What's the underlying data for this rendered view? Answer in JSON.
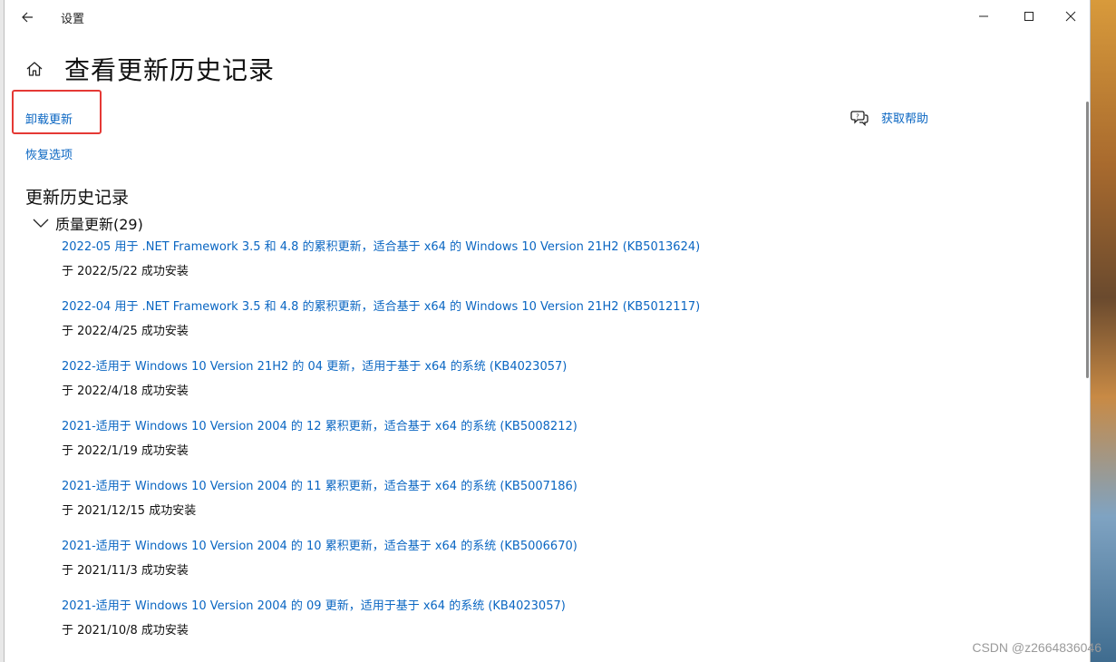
{
  "window": {
    "title": "设置",
    "controls": {
      "minimize": "minimize-icon",
      "maximize": "maximize-icon",
      "close": "close-icon"
    }
  },
  "header": {
    "title": "查看更新历史记录"
  },
  "actions": {
    "uninstall": "卸载更新",
    "recovery": "恢复选项",
    "help": "获取帮助"
  },
  "history": {
    "section_title": "更新历史记录",
    "group_label": "质量更新(29)",
    "items": [
      {
        "title": "2022-05 用于 .NET Framework 3.5 和 4.8 的累积更新，适合基于 x64 的 Windows 10 Version 21H2 (KB5013624)",
        "status": "于 2022/5/22 成功安装"
      },
      {
        "title": "2022-04 用于 .NET Framework 3.5 和 4.8 的累积更新，适合基于 x64 的 Windows 10 Version 21H2 (KB5012117)",
        "status": "于 2022/4/25 成功安装"
      },
      {
        "title": "2022-适用于 Windows 10 Version 21H2 的 04 更新，适用于基于 x64 的系统 (KB4023057)",
        "status": "于 2022/4/18 成功安装"
      },
      {
        "title": "2021-适用于 Windows 10 Version 2004 的 12 累积更新，适合基于 x64 的系统 (KB5008212)",
        "status": "于 2022/1/19 成功安装"
      },
      {
        "title": "2021-适用于 Windows 10 Version 2004 的 11 累积更新，适合基于 x64 的系统 (KB5007186)",
        "status": "于 2021/12/15 成功安装"
      },
      {
        "title": "2021-适用于 Windows 10 Version 2004 的 10 累积更新，适合基于 x64 的系统 (KB5006670)",
        "status": "于 2021/11/3 成功安装"
      },
      {
        "title": "2021-适用于 Windows 10 Version 2004 的 09 更新，适用于基于 x64 的系统 (KB4023057)",
        "status": "于 2021/10/8 成功安装"
      }
    ]
  },
  "watermark": "CSDN @z2664836046",
  "colors": {
    "link": "#0a66c2",
    "highlight_box": "#e53935"
  }
}
